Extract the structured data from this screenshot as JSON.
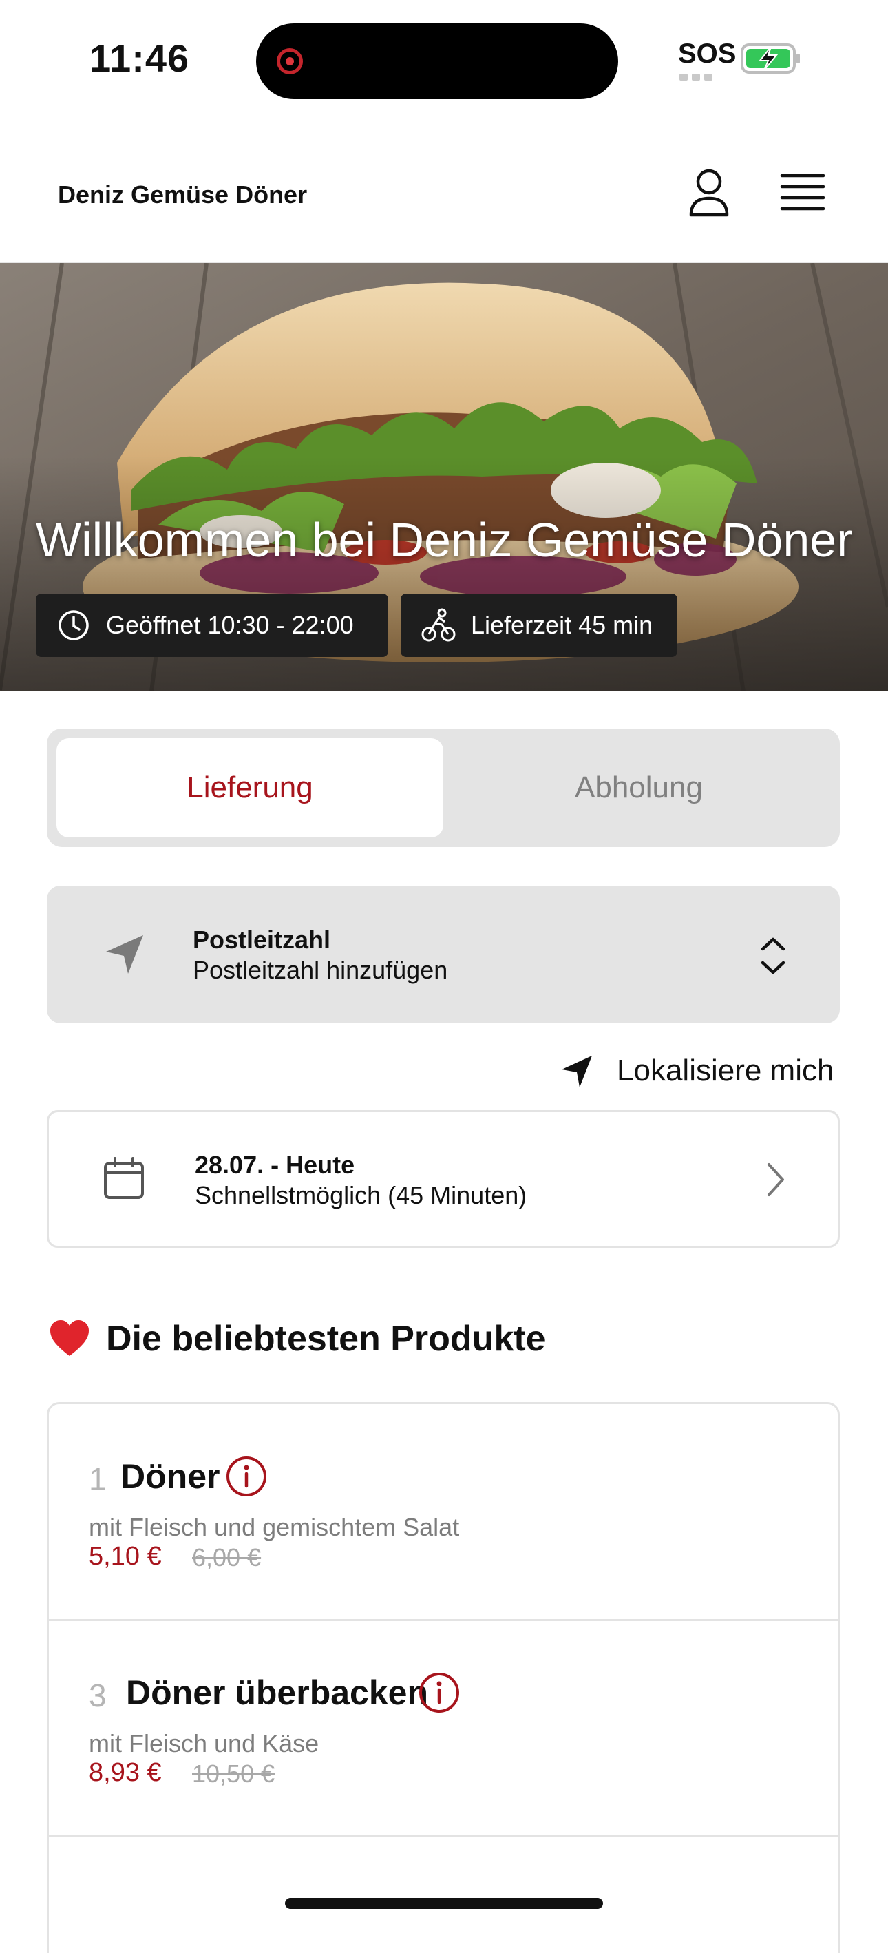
{
  "status_bar": {
    "time": "11:46",
    "sos": "SOS"
  },
  "header": {
    "title": "Deniz Gemüse Döner"
  },
  "hero": {
    "title": "Willkommen bei Deniz Gemüse Döner",
    "open_hours": "Geöffnet 10:30 - 22:00",
    "delivery_time": "Lieferzeit 45 min"
  },
  "order_mode": {
    "delivery": "Lieferung",
    "pickup": "Abholung",
    "selected": "Lieferung"
  },
  "postcode": {
    "label": "Postleitzahl",
    "placeholder": "Postleitzahl hinzufügen"
  },
  "locate": {
    "label": "Lokalisiere mich"
  },
  "date": {
    "day": "28.07. - Heute",
    "slot": "Schnellstmöglich (45 Minuten)"
  },
  "popular": {
    "title": "Die beliebtesten Produkte",
    "items": [
      {
        "number": "1",
        "name": "Döner",
        "description": "mit Fleisch und gemischtem Salat",
        "price": "5,10 €",
        "old_price": "6,00 €"
      },
      {
        "number": "3",
        "name": "Döner überbacken",
        "description": "mit Fleisch und Käse",
        "price": "8,93 €",
        "old_price": "10,50 €"
      }
    ]
  },
  "colors": {
    "accent": "#a7141c",
    "panel": "#e4e4e4",
    "badge": "#1e1e1e"
  }
}
